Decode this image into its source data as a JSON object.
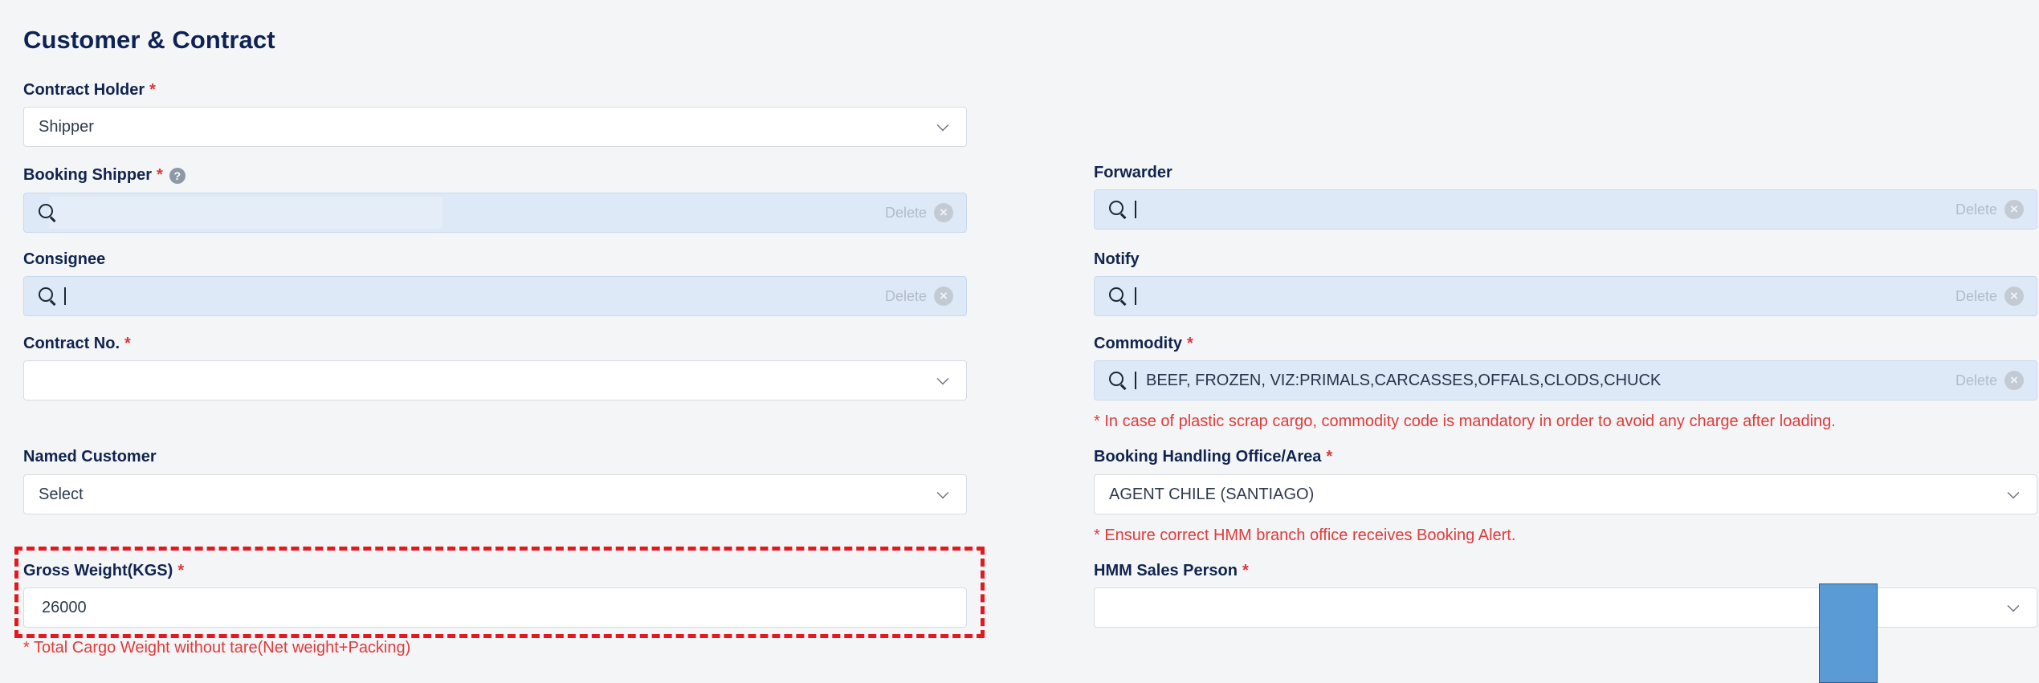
{
  "section_title": "Customer & Contract",
  "required_mark": "*",
  "fields": {
    "contract_holder": {
      "label": "Contract Holder",
      "value": "Shipper"
    },
    "booking_shipper": {
      "label": "Booking Shipper",
      "value": "",
      "delete_label": "Delete"
    },
    "forwarder": {
      "label": "Forwarder",
      "value": "",
      "delete_label": "Delete"
    },
    "consignee": {
      "label": "Consignee",
      "value": "",
      "delete_label": "Delete"
    },
    "notify": {
      "label": "Notify",
      "value": "",
      "delete_label": "Delete"
    },
    "contract_no": {
      "label": "Contract No.",
      "value": ""
    },
    "commodity": {
      "label": "Commodity",
      "value": "BEEF, FROZEN, VIZ:PRIMALS,CARCASSES,OFFALS,CLODS,CHUCK",
      "delete_label": "Delete",
      "note": "* In case of plastic scrap cargo, commodity code is mandatory in order to avoid any charge after loading."
    },
    "named_customer": {
      "label": "Named Customer",
      "value": "Select"
    },
    "booking_office": {
      "label": "Booking Handling Office/Area",
      "value": "AGENT CHILE (SANTIAGO)",
      "note": "* Ensure correct HMM branch office receives Booking Alert."
    },
    "gross_weight": {
      "label": "Gross Weight(KGS)",
      "value": "26000",
      "note": "* Total Cargo Weight without tare(Net weight+Packing)"
    },
    "hmm_sales_person": {
      "label": "HMM Sales Person",
      "value": ""
    }
  },
  "icons": {
    "help": "?",
    "clear": "×"
  },
  "colors": {
    "title": "#0e2354",
    "required": "#e0363a",
    "search_field_bg": "#dde9f6",
    "highlight_border": "#e3191f",
    "overlay_bar": "#5b9bd5"
  }
}
